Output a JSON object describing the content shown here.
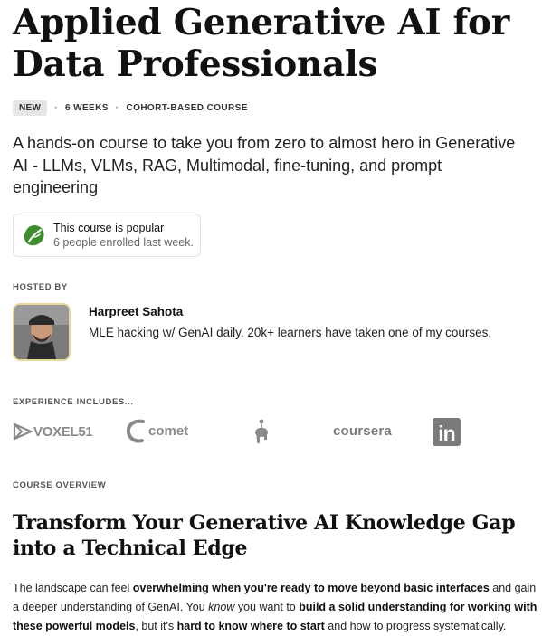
{
  "course": {
    "title": "Applied Generative AI for Data Professionals",
    "badge": "NEW",
    "duration": "6 WEEKS",
    "format": "COHORT-BASED COURSE",
    "subtitle": "A hands-on course to take you from zero to almost hero in Generative AI - LLMs, VLMs, RAG, Multimodal, fine-tuning, and prompt engineering"
  },
  "popularity": {
    "title": "This course is popular",
    "detail": "6 people enrolled last week.",
    "icon": "leaf-icon",
    "accent": "#3e8e2e"
  },
  "host": {
    "section_label": "HOSTED BY",
    "name": "Harpreet Sahota",
    "bio": "MLE hacking w/ GenAI daily. 20k+ learners have taken one of my courses."
  },
  "experience": {
    "section_label": "EXPERIENCE INCLUDES...",
    "logos": {
      "voxel51": "VOXEL51",
      "comet": "comet",
      "elephant": "elephant-logo-icon",
      "coursera": "coursera",
      "linkedin": "in"
    }
  },
  "overview": {
    "section_label": "COURSE OVERVIEW",
    "heading": "Transform Your Generative AI Knowledge Gap into a Technical Edge",
    "p_part1": "The landscape can feel ",
    "p_bold1": "overwhelming when you're ready to move beyond basic interfaces",
    "p_part2": " and gain a deeper understanding of GenAI. You ",
    "p_ital1": "know",
    "p_part3": " you want to ",
    "p_bold2": "build a solid understanding for working with these powerful models",
    "p_part4": ", but it's ",
    "p_bold3": "hard to know where to start",
    "p_part5": " and how to progress systematically."
  }
}
